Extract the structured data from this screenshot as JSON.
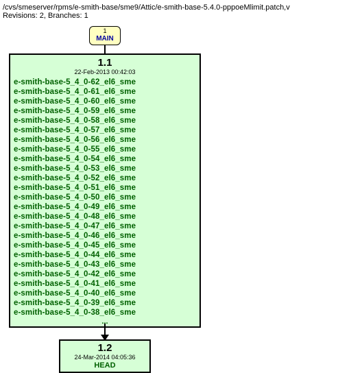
{
  "header": {
    "path": "/cvs/smeserver/rpms/e-smith-base/sme9/Attic/e-smith-base-5.4.0-pppoeMlimit.patch,v",
    "revisions_line": "Revisions: 2, Branches: 1"
  },
  "main_tag": {
    "index": "1",
    "label": "MAIN"
  },
  "rev1": {
    "number": "1.1",
    "date": "22-Feb-2013 00:42:03",
    "files": [
      "e-smith-base-5_4_0-62_el6_sme",
      "e-smith-base-5_4_0-61_el6_sme",
      "e-smith-base-5_4_0-60_el6_sme",
      "e-smith-base-5_4_0-59_el6_sme",
      "e-smith-base-5_4_0-58_el6_sme",
      "e-smith-base-5_4_0-57_el6_sme",
      "e-smith-base-5_4_0-56_el6_sme",
      "e-smith-base-5_4_0-55_el6_sme",
      "e-smith-base-5_4_0-54_el6_sme",
      "e-smith-base-5_4_0-53_el6_sme",
      "e-smith-base-5_4_0-52_el6_sme",
      "e-smith-base-5_4_0-51_el6_sme",
      "e-smith-base-5_4_0-50_el6_sme",
      "e-smith-base-5_4_0-49_el6_sme",
      "e-smith-base-5_4_0-48_el6_sme",
      "e-smith-base-5_4_0-47_el6_sme",
      "e-smith-base-5_4_0-46_el6_sme",
      "e-smith-base-5_4_0-45_el6_sme",
      "e-smith-base-5_4_0-44_el6_sme",
      "e-smith-base-5_4_0-43_el6_sme",
      "e-smith-base-5_4_0-42_el6_sme",
      "e-smith-base-5_4_0-41_el6_sme",
      "e-smith-base-5_4_0-40_el6_sme",
      "e-smith-base-5_4_0-39_el6_sme",
      "e-smith-base-5_4_0-38_el6_sme"
    ],
    "ellipsis": "..."
  },
  "rev2": {
    "number": "1.2",
    "date": "24-Mar-2014 04:05:36",
    "head_label": "HEAD"
  }
}
